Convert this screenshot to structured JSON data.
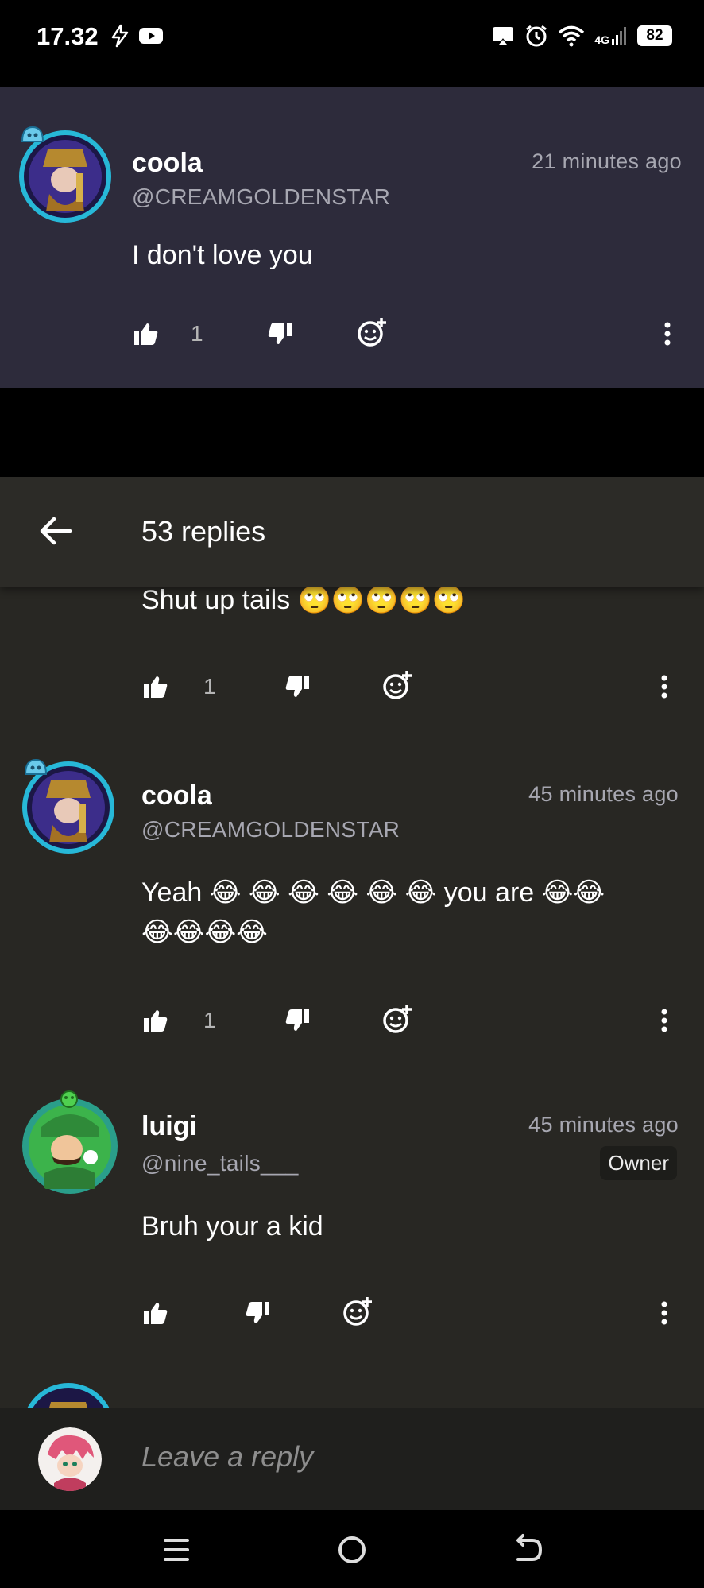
{
  "status": {
    "time": "17.32",
    "network": "4G",
    "battery": "82"
  },
  "parent": {
    "name": "coola",
    "handle": "@CREAMGOLDENSTAR",
    "time": "21 minutes ago",
    "text": "I don't love you",
    "likes": "1"
  },
  "sheet": {
    "title": "53 replies"
  },
  "replies": [
    {
      "text": "Shut up tails 🙄🙄🙄🙄🙄",
      "likes": "1"
    },
    {
      "name": "coola",
      "handle": "@CREAMGOLDENSTAR",
      "time": "45 minutes ago",
      "text_line1": "Yeah 😂 😂 😂 😂 😂 😂 you are 😂😂",
      "text_line2": "😂😂😂😂",
      "likes": "1"
    },
    {
      "name": "luigi",
      "handle": "@nine_tails___",
      "time": "45 minutes ago",
      "badge": "Owner",
      "text": "Bruh your a kid"
    }
  ],
  "reply_bar": {
    "placeholder": "Leave a reply"
  },
  "icons": [
    "thumb-up-icon",
    "thumb-down-icon",
    "add-reaction-icon",
    "more-vert-icon",
    "back-arrow-icon"
  ]
}
